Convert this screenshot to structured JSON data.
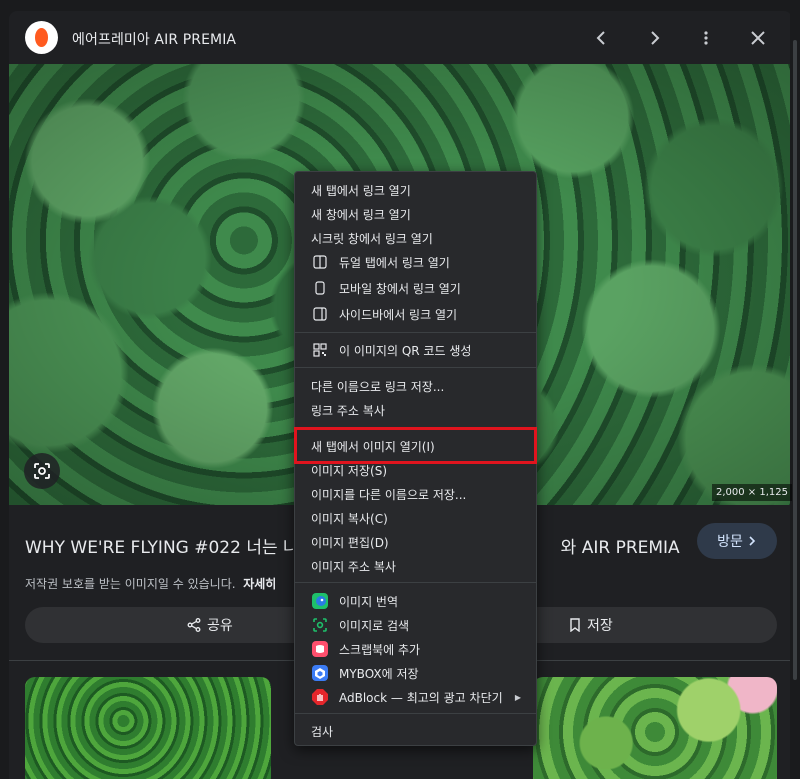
{
  "header": {
    "site_title": "에어프레미아 AIR PREMIA"
  },
  "image": {
    "dimensions": "2,000 × 1,125"
  },
  "details": {
    "headline_start": "WHY WE'RE FLYING #022 너는 나",
    "headline_end": "와 AIR PREMIA",
    "visit_label": "방문",
    "copyright_text": "저작권 보호를 받는 이미지일 수 있습니다.",
    "learn_more": "자세히",
    "share_label": "공유",
    "save_label": "저장"
  },
  "context_menu": {
    "items": [
      {
        "label": "새 탭에서 링크 열기",
        "icon": ""
      },
      {
        "label": "새 창에서 링크 열기",
        "icon": ""
      },
      {
        "label": "시크릿 창에서 링크 열기",
        "icon": ""
      },
      {
        "label": "듀얼 탭에서 링크 열기",
        "icon": "dual-tab-icon"
      },
      {
        "label": "모바일 창에서 링크 열기",
        "icon": "mobile-window-icon"
      },
      {
        "label": "사이드바에서 링크 열기",
        "icon": "sidebar-icon"
      },
      {
        "label": "이 이미지의 QR 코드 생성",
        "icon": "qr-code-icon"
      },
      {
        "label": "다른 이름으로 링크 저장...",
        "icon": ""
      },
      {
        "label": "링크 주소 복사",
        "icon": ""
      },
      {
        "label": "새 탭에서 이미지 열기(I)",
        "icon": ""
      },
      {
        "label": "이미지 저장(S)",
        "icon": ""
      },
      {
        "label": "이미지를 다른 이름으로 저장...",
        "icon": ""
      },
      {
        "label": "이미지 복사(C)",
        "icon": ""
      },
      {
        "label": "이미지 편집(D)",
        "icon": ""
      },
      {
        "label": "이미지 주소 복사",
        "icon": ""
      },
      {
        "label": "이미지 번역",
        "icon": "papago-translate-icon"
      },
      {
        "label": "이미지로 검색",
        "icon": "image-search-icon"
      },
      {
        "label": "스크랩북에 추가",
        "icon": "scrapbook-icon"
      },
      {
        "label": "MYBOX에 저장",
        "icon": "mybox-icon"
      },
      {
        "label": "AdBlock — 최고의 광고 차단기",
        "icon": "adblock-icon"
      },
      {
        "label": "검사",
        "icon": ""
      }
    ]
  },
  "colors": {
    "highlight": "#e0141e",
    "brand": "#ff5a1f",
    "menu_bg": "#28292c"
  }
}
